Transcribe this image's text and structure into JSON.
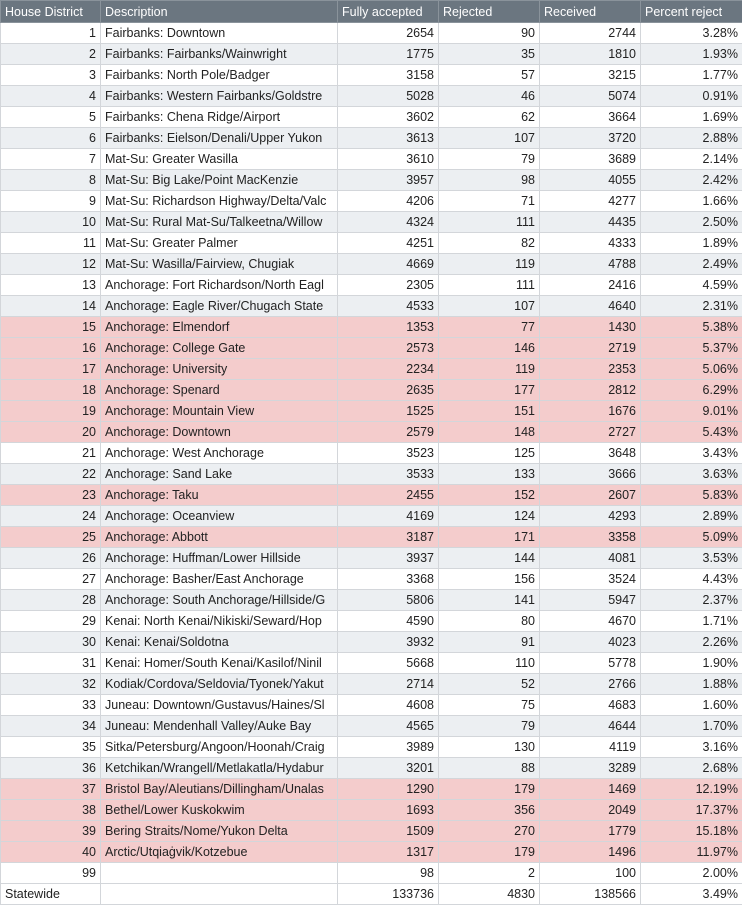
{
  "columns": [
    "House District",
    "Description",
    "Fully accepted",
    "Rejected",
    "Received",
    "Percent reject"
  ],
  "rows": [
    {
      "district": "1",
      "description": "Fairbanks: Downtown",
      "accepted": "2654",
      "rejected": "90",
      "received": "2744",
      "percent": "3.28%",
      "highlight": false
    },
    {
      "district": "2",
      "description": "Fairbanks: Fairbanks/Wainwright",
      "accepted": "1775",
      "rejected": "35",
      "received": "1810",
      "percent": "1.93%",
      "highlight": false
    },
    {
      "district": "3",
      "description": "Fairbanks: North Pole/Badger",
      "accepted": "3158",
      "rejected": "57",
      "received": "3215",
      "percent": "1.77%",
      "highlight": false
    },
    {
      "district": "4",
      "description": "Fairbanks: Western Fairbanks/Goldstre",
      "accepted": "5028",
      "rejected": "46",
      "received": "5074",
      "percent": "0.91%",
      "highlight": false
    },
    {
      "district": "5",
      "description": "Fairbanks: Chena Ridge/Airport",
      "accepted": "3602",
      "rejected": "62",
      "received": "3664",
      "percent": "1.69%",
      "highlight": false
    },
    {
      "district": "6",
      "description": "Fairbanks: Eielson/Denali/Upper Yukon",
      "accepted": "3613",
      "rejected": "107",
      "received": "3720",
      "percent": "2.88%",
      "highlight": false
    },
    {
      "district": "7",
      "description": "Mat-Su: Greater Wasilla",
      "accepted": "3610",
      "rejected": "79",
      "received": "3689",
      "percent": "2.14%",
      "highlight": false
    },
    {
      "district": "8",
      "description": "Mat-Su: Big Lake/Point MacKenzie",
      "accepted": "3957",
      "rejected": "98",
      "received": "4055",
      "percent": "2.42%",
      "highlight": false
    },
    {
      "district": "9",
      "description": "Mat-Su: Richardson Highway/Delta/Valc",
      "accepted": "4206",
      "rejected": "71",
      "received": "4277",
      "percent": "1.66%",
      "highlight": false
    },
    {
      "district": "10",
      "description": "Mat-Su: Rural Mat-Su/Talkeetna/Willow",
      "accepted": "4324",
      "rejected": "111",
      "received": "4435",
      "percent": "2.50%",
      "highlight": false
    },
    {
      "district": "11",
      "description": "Mat-Su: Greater Palmer",
      "accepted": "4251",
      "rejected": "82",
      "received": "4333",
      "percent": "1.89%",
      "highlight": false
    },
    {
      "district": "12",
      "description": "Mat-Su: Wasilla/Fairview, Chugiak",
      "accepted": "4669",
      "rejected": "119",
      "received": "4788",
      "percent": "2.49%",
      "highlight": false
    },
    {
      "district": "13",
      "description": "Anchorage: Fort Richardson/North Eagl",
      "accepted": "2305",
      "rejected": "111",
      "received": "2416",
      "percent": "4.59%",
      "highlight": false
    },
    {
      "district": "14",
      "description": "Anchorage: Eagle River/Chugach State",
      "accepted": "4533",
      "rejected": "107",
      "received": "4640",
      "percent": "2.31%",
      "highlight": false
    },
    {
      "district": "15",
      "description": "Anchorage: Elmendorf",
      "accepted": "1353",
      "rejected": "77",
      "received": "1430",
      "percent": "5.38%",
      "highlight": true
    },
    {
      "district": "16",
      "description": "Anchorage: College Gate",
      "accepted": "2573",
      "rejected": "146",
      "received": "2719",
      "percent": "5.37%",
      "highlight": true
    },
    {
      "district": "17",
      "description": "Anchorage: University",
      "accepted": "2234",
      "rejected": "119",
      "received": "2353",
      "percent": "5.06%",
      "highlight": true
    },
    {
      "district": "18",
      "description": "Anchorage: Spenard",
      "accepted": "2635",
      "rejected": "177",
      "received": "2812",
      "percent": "6.29%",
      "highlight": true
    },
    {
      "district": "19",
      "description": "Anchorage: Mountain View",
      "accepted": "1525",
      "rejected": "151",
      "received": "1676",
      "percent": "9.01%",
      "highlight": true
    },
    {
      "district": "20",
      "description": "Anchorage: Downtown",
      "accepted": "2579",
      "rejected": "148",
      "received": "2727",
      "percent": "5.43%",
      "highlight": true
    },
    {
      "district": "21",
      "description": "Anchorage: West Anchorage",
      "accepted": "3523",
      "rejected": "125",
      "received": "3648",
      "percent": "3.43%",
      "highlight": false
    },
    {
      "district": "22",
      "description": "Anchorage: Sand Lake",
      "accepted": "3533",
      "rejected": "133",
      "received": "3666",
      "percent": "3.63%",
      "highlight": false
    },
    {
      "district": "23",
      "description": "Anchorage: Taku",
      "accepted": "2455",
      "rejected": "152",
      "received": "2607",
      "percent": "5.83%",
      "highlight": true
    },
    {
      "district": "24",
      "description": "Anchorage: Oceanview",
      "accepted": "4169",
      "rejected": "124",
      "received": "4293",
      "percent": "2.89%",
      "highlight": false
    },
    {
      "district": "25",
      "description": "Anchorage: Abbott",
      "accepted": "3187",
      "rejected": "171",
      "received": "3358",
      "percent": "5.09%",
      "highlight": true
    },
    {
      "district": "26",
      "description": "Anchorage: Huffman/Lower Hillside",
      "accepted": "3937",
      "rejected": "144",
      "received": "4081",
      "percent": "3.53%",
      "highlight": false
    },
    {
      "district": "27",
      "description": "Anchorage: Basher/East Anchorage",
      "accepted": "3368",
      "rejected": "156",
      "received": "3524",
      "percent": "4.43%",
      "highlight": false
    },
    {
      "district": "28",
      "description": "Anchorage: South Anchorage/Hillside/G",
      "accepted": "5806",
      "rejected": "141",
      "received": "5947",
      "percent": "2.37%",
      "highlight": false
    },
    {
      "district": "29",
      "description": "Kenai: North Kenai/Nikiski/Seward/Hop",
      "accepted": "4590",
      "rejected": "80",
      "received": "4670",
      "percent": "1.71%",
      "highlight": false
    },
    {
      "district": "30",
      "description": "Kenai: Kenai/Soldotna",
      "accepted": "3932",
      "rejected": "91",
      "received": "4023",
      "percent": "2.26%",
      "highlight": false
    },
    {
      "district": "31",
      "description": "Kenai: Homer/South Kenai/Kasilof/Ninil",
      "accepted": "5668",
      "rejected": "110",
      "received": "5778",
      "percent": "1.90%",
      "highlight": false
    },
    {
      "district": "32",
      "description": "Kodiak/Cordova/Seldovia/Tyonek/Yakut",
      "accepted": "2714",
      "rejected": "52",
      "received": "2766",
      "percent": "1.88%",
      "highlight": false
    },
    {
      "district": "33",
      "description": "Juneau: Downtown/Gustavus/Haines/Sl",
      "accepted": "4608",
      "rejected": "75",
      "received": "4683",
      "percent": "1.60%",
      "highlight": false
    },
    {
      "district": "34",
      "description": "Juneau: Mendenhall Valley/Auke Bay",
      "accepted": "4565",
      "rejected": "79",
      "received": "4644",
      "percent": "1.70%",
      "highlight": false
    },
    {
      "district": "35",
      "description": "Sitka/Petersburg/Angoon/Hoonah/Craig",
      "accepted": "3989",
      "rejected": "130",
      "received": "4119",
      "percent": "3.16%",
      "highlight": false
    },
    {
      "district": "36",
      "description": "Ketchikan/Wrangell/Metlakatla/Hydabur",
      "accepted": "3201",
      "rejected": "88",
      "received": "3289",
      "percent": "2.68%",
      "highlight": false
    },
    {
      "district": "37",
      "description": "Bristol Bay/Aleutians/Dillingham/Unalas",
      "accepted": "1290",
      "rejected": "179",
      "received": "1469",
      "percent": "12.19%",
      "highlight": true
    },
    {
      "district": "38",
      "description": "Bethel/Lower Kuskokwim",
      "accepted": "1693",
      "rejected": "356",
      "received": "2049",
      "percent": "17.37%",
      "highlight": true
    },
    {
      "district": "39",
      "description": "Bering Straits/Nome/Yukon Delta",
      "accepted": "1509",
      "rejected": "270",
      "received": "1779",
      "percent": "15.18%",
      "highlight": true
    },
    {
      "district": "40",
      "description": "Arctic/Utqiaġvik/Kotzebue",
      "accepted": "1317",
      "rejected": "179",
      "received": "1496",
      "percent": "11.97%",
      "highlight": true
    },
    {
      "district": "99",
      "description": "",
      "accepted": "98",
      "received": "100",
      "rejected": "2",
      "percent": "2.00%",
      "highlight": false
    }
  ],
  "total": {
    "label": "Statewide",
    "description": "",
    "accepted": "133736",
    "rejected": "4830",
    "received": "138566",
    "percent": "3.49%"
  },
  "colors": {
    "header_bg": "#6b7680",
    "highlight_bg": "#f4cccc",
    "stripe_bg": "#eceff2"
  }
}
